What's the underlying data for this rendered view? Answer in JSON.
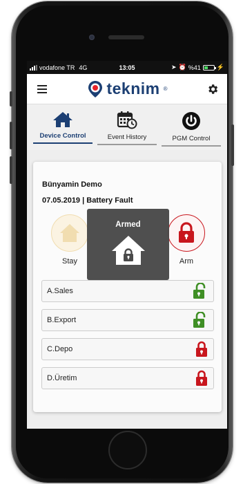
{
  "status_bar": {
    "carrier": "vodafone TR",
    "network": "4G",
    "time": "13:05",
    "battery_text": "%41"
  },
  "header": {
    "brand": "teknim",
    "brand_mark": "®",
    "menu_icon": "hamburger-icon",
    "settings_icon": "gear-icon"
  },
  "tabs": [
    {
      "label": "Device Control",
      "icon": "home-icon",
      "active": true
    },
    {
      "label": "Event History",
      "icon": "calendar-clock-icon",
      "active": false
    },
    {
      "label": "PGM Control",
      "icon": "power-icon",
      "active": false
    }
  ],
  "device": {
    "name": "Bünyamin Demo",
    "status_line": "07.05.2019 | Battery Fault"
  },
  "modes": {
    "stay_label": "Stay",
    "arm_label": "Arm"
  },
  "toast": {
    "title": "Armed"
  },
  "partitions": [
    {
      "name": "A.Sales",
      "state": "unlocked"
    },
    {
      "name": "B.Export",
      "state": "unlocked"
    },
    {
      "name": "C.Depo",
      "state": "locked"
    },
    {
      "name": "D.Üretim",
      "state": "locked"
    }
  ],
  "colors": {
    "brand": "#1c3f73",
    "armed_red": "#c8161d",
    "disarmed_green": "#3f8f25",
    "stay_beige": "#f1ddb0"
  }
}
